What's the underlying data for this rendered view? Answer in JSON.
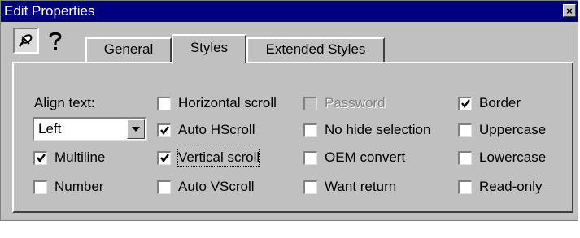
{
  "window": {
    "title": "Edit Properties",
    "close_glyph": "×"
  },
  "toolbar": {
    "pushpin_icon": "pushpin-icon",
    "help_icon": "question-mark-icon"
  },
  "tabs": [
    {
      "label": "General",
      "active": false
    },
    {
      "label": "Styles",
      "active": true
    },
    {
      "label": "Extended Styles",
      "active": false
    }
  ],
  "align": {
    "label": "Align text:",
    "value": "Left"
  },
  "checkboxes": {
    "multiline": {
      "label": "Multiline",
      "checked": true
    },
    "number": {
      "label": "Number",
      "checked": false
    },
    "horizontal_scroll": {
      "label": "Horizontal scroll",
      "checked": false
    },
    "auto_hscroll": {
      "label": "Auto HScroll",
      "checked": true
    },
    "vertical_scroll": {
      "label": "Vertical scroll",
      "checked": true,
      "focused": true
    },
    "auto_vscroll": {
      "label": "Auto VScroll",
      "checked": false
    },
    "password": {
      "label": "Password",
      "checked": false,
      "disabled": true
    },
    "no_hide_selection": {
      "label": "No hide selection",
      "checked": false
    },
    "oem_convert": {
      "label": "OEM convert",
      "checked": false
    },
    "want_return": {
      "label": "Want return",
      "checked": false
    },
    "border": {
      "label": "Border",
      "checked": true
    },
    "uppercase": {
      "label": "Uppercase",
      "checked": false
    },
    "lowercase": {
      "label": "Lowercase",
      "checked": false
    },
    "read_only": {
      "label": "Read-only",
      "checked": false
    }
  },
  "colors": {
    "face": "#c0c0c0",
    "titlebar": "#000080",
    "disabled_text": "#808080"
  }
}
